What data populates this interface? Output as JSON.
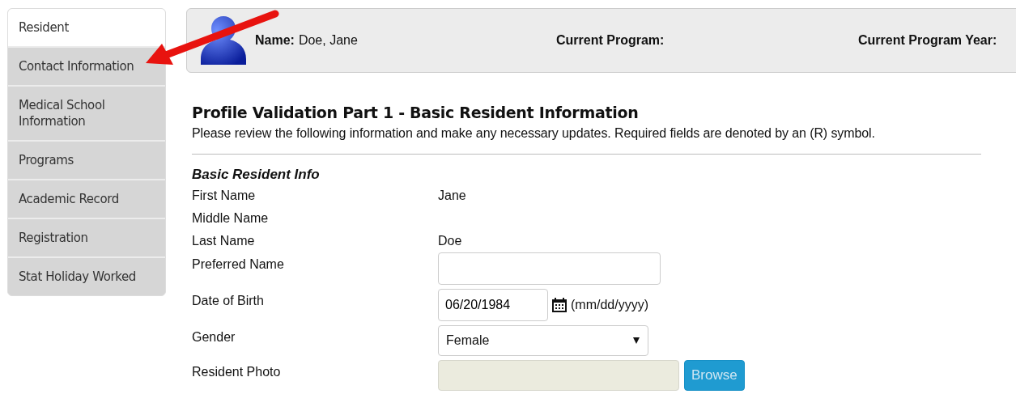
{
  "sidebar": {
    "items": [
      {
        "label": "Resident",
        "selected": true
      },
      {
        "label": "Contact Information",
        "selected": false
      },
      {
        "label": "Medical School Information",
        "selected": false
      },
      {
        "label": "Programs",
        "selected": false
      },
      {
        "label": "Academic Record",
        "selected": false
      },
      {
        "label": "Registration",
        "selected": false
      },
      {
        "label": "Stat Holiday Worked",
        "selected": false
      }
    ]
  },
  "header": {
    "fields": [
      {
        "label": "Name:",
        "value": "Doe, Jane"
      },
      {
        "label": "Current Program:"
      },
      {
        "label": "Current Program Year:"
      }
    ]
  },
  "section": {
    "title": "Profile Validation Part 1 - Basic Resident Information",
    "intro": "Please review the following information and make any necessary updates. Required fields are denoted by an (R) symbol.",
    "subtitle": "Basic Resident Info",
    "fields": [
      {
        "label": "First Name",
        "kind": "text",
        "value": "Jane"
      },
      {
        "label": "Middle Name",
        "kind": "text"
      },
      {
        "label": "Last Name",
        "kind": "text",
        "value": "Doe"
      },
      {
        "label": "Preferred Name",
        "kind": "input"
      },
      {
        "label": "Date of Birth",
        "kind": "date",
        "value": "06/20/1984",
        "hint": "(mm/dd/yyyy)"
      },
      {
        "label": "Gender",
        "kind": "select",
        "value": "Female"
      },
      {
        "label": "Resident Photo",
        "kind": "file",
        "button": "Browse"
      }
    ]
  }
}
